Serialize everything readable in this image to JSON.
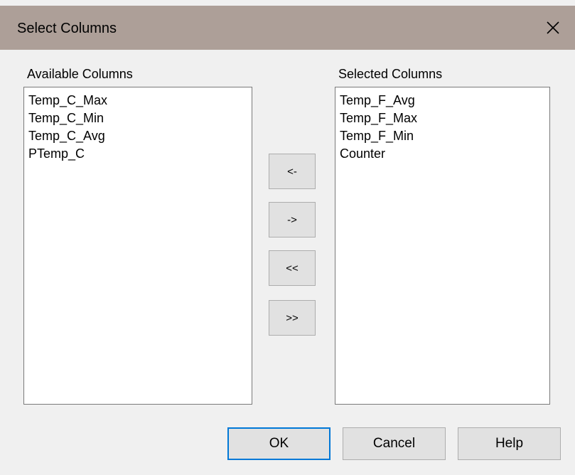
{
  "window": {
    "title": "Select Columns",
    "close_glyph": "✕"
  },
  "available": {
    "label": "Available Columns",
    "items": [
      "Temp_C_Max",
      "Temp_C_Min",
      "Temp_C_Avg",
      "PTemp_C"
    ]
  },
  "selected": {
    "label": "Selected Columns",
    "items": [
      "Temp_F_Avg",
      "Temp_F_Max",
      "Temp_F_Min",
      "Counter"
    ]
  },
  "move_buttons": {
    "remove_one": "<-",
    "add_one": "->",
    "remove_all": "<<",
    "add_all": ">>"
  },
  "footer": {
    "ok": "OK",
    "cancel": "Cancel",
    "help": "Help"
  },
  "colors": {
    "titlebar": "#ad9f98",
    "default_button_border": "#0078d7"
  }
}
